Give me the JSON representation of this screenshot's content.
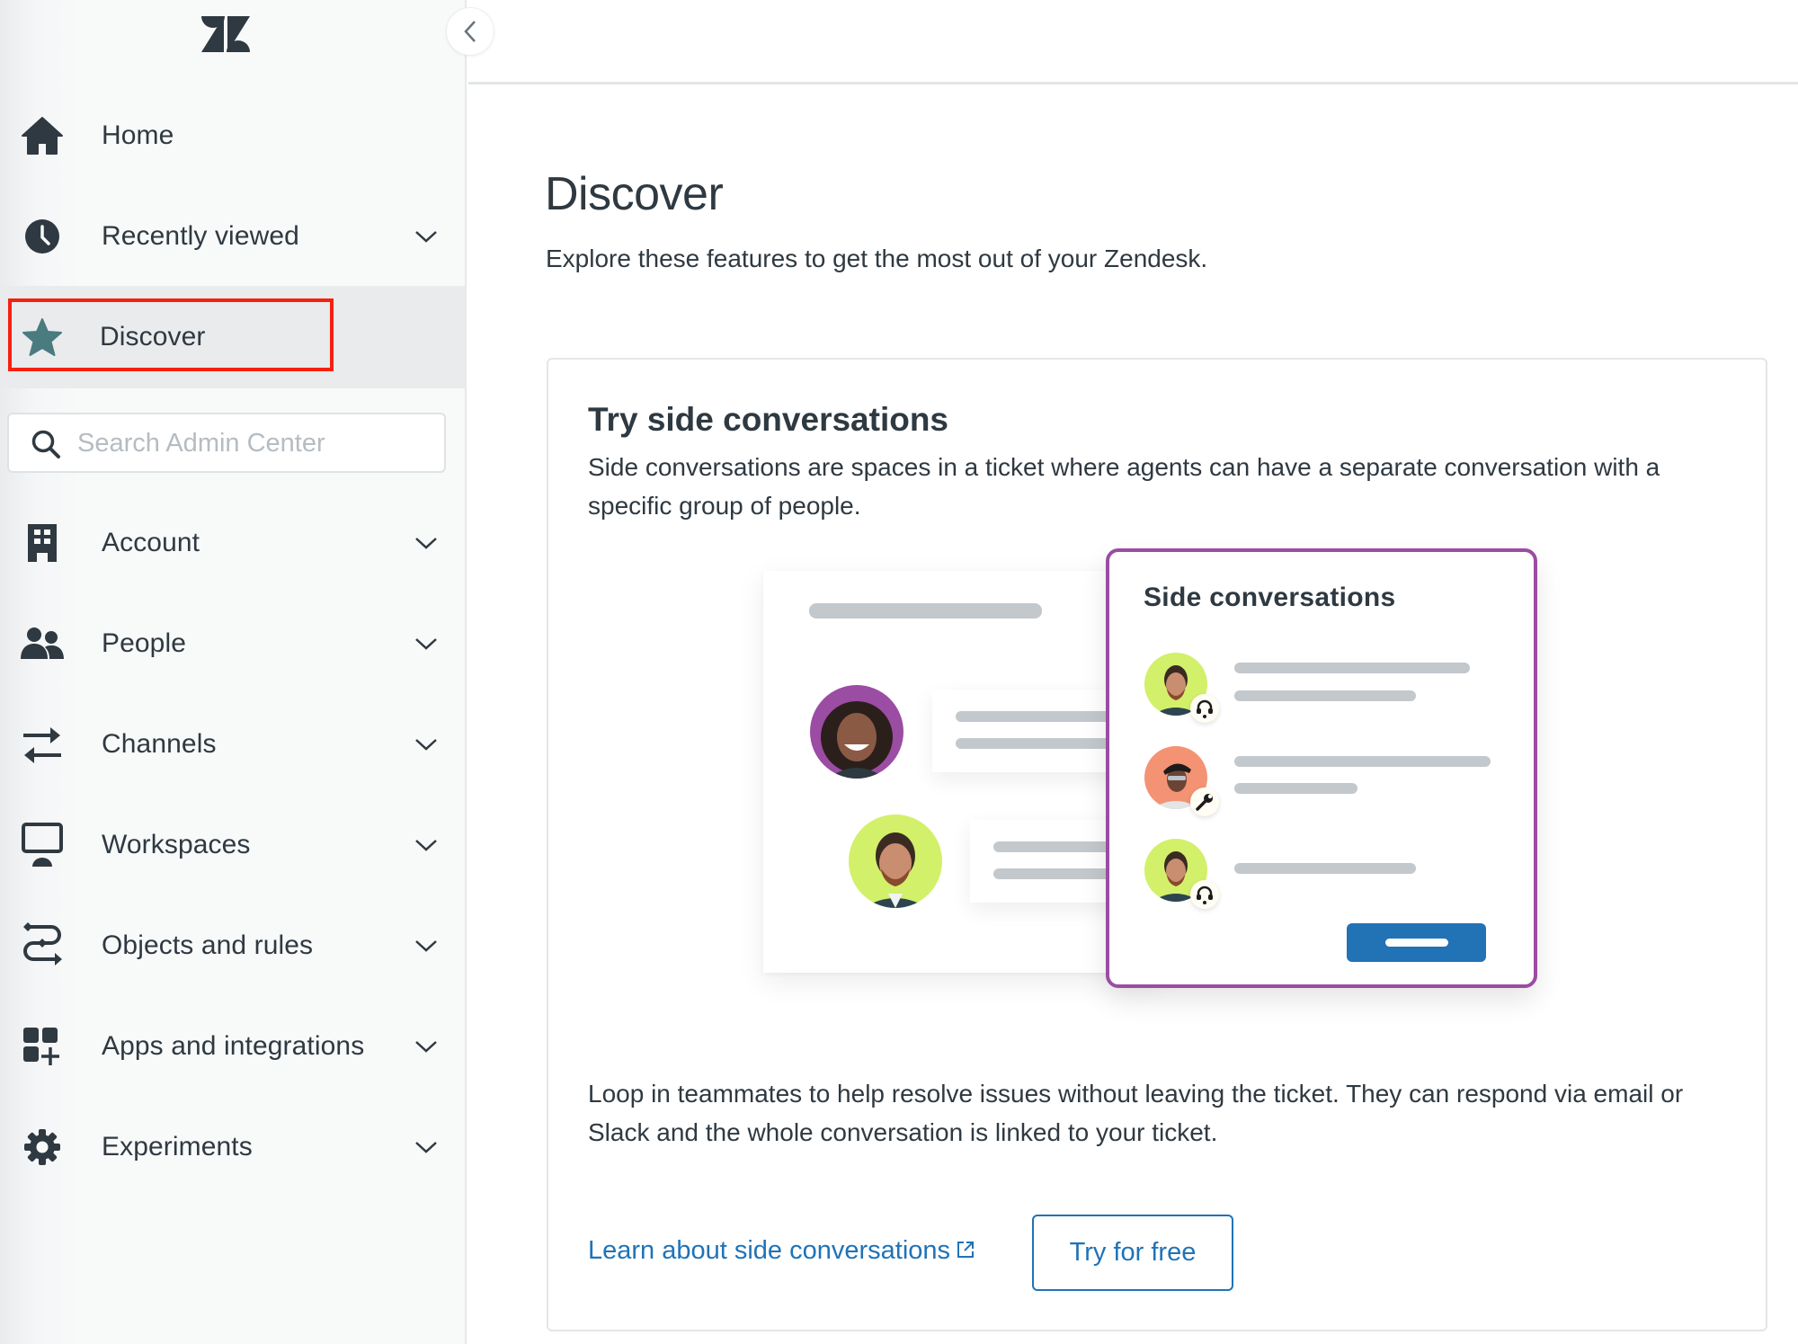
{
  "app": {
    "brand": "Zendesk",
    "logo_icon": "zendesk-logo",
    "collapse_icon": "chevron-left-icon"
  },
  "sidebar": {
    "items": [
      {
        "id": "home",
        "label": "Home",
        "icon": "home-icon",
        "expandable": false,
        "active": false
      },
      {
        "id": "recently-viewed",
        "label": "Recently viewed",
        "icon": "clock-icon",
        "expandable": true,
        "active": false
      },
      {
        "id": "discover",
        "label": "Discover",
        "icon": "star-icon",
        "expandable": false,
        "active": true
      },
      {
        "id": "account",
        "label": "Account",
        "icon": "building-icon",
        "expandable": true,
        "active": false
      },
      {
        "id": "people",
        "label": "People",
        "icon": "people-icon",
        "expandable": true,
        "active": false
      },
      {
        "id": "channels",
        "label": "Channels",
        "icon": "arrows-swap-icon",
        "expandable": true,
        "active": false
      },
      {
        "id": "workspaces",
        "label": "Workspaces",
        "icon": "monitor-icon",
        "expandable": true,
        "active": false
      },
      {
        "id": "objects-and-rules",
        "label": "Objects and rules",
        "icon": "flow-icon",
        "expandable": true,
        "active": false
      },
      {
        "id": "apps-and-integrations",
        "label": "Apps and integrations",
        "icon": "apps-grid-plus-icon",
        "expandable": true,
        "active": false
      },
      {
        "id": "experiments",
        "label": "Experiments",
        "icon": "gear-icon",
        "expandable": true,
        "active": false
      }
    ],
    "search": {
      "placeholder": "Search Admin Center",
      "value": "",
      "icon": "search-icon"
    },
    "highlight_color": "#f5210f",
    "active_icon_color": "#4a7b7f"
  },
  "main": {
    "title": "Discover",
    "subtitle": "Explore these features to get the most out of your Zendesk.",
    "card": {
      "title": "Try side conversations",
      "description": "Side conversations are spaces in a ticket where agents can have a separate conversation with a specific group of people.",
      "illustration": {
        "panel_title": "Side conversations",
        "panel_border_color": "#9b4ca3",
        "button_color": "#2272b6",
        "participants": [
          {
            "avatar_bg": "#d2f06a",
            "role_icon": "headset-icon"
          },
          {
            "avatar_bg": "#f49374",
            "role_icon": "wrench-icon"
          },
          {
            "avatar_bg": "#d2f06a",
            "role_icon": "headset-icon"
          }
        ],
        "ticket_avatars": [
          {
            "avatar_bg": "#9b4ca3"
          },
          {
            "avatar_bg": "#d2f06a"
          }
        ]
      },
      "body": "Loop in teammates to help resolve issues without leaving the ticket. They can respond via email or Slack and the whole conversation is linked to your ticket.",
      "learn_link": "Learn about side conversations",
      "learn_link_icon": "external-link-icon",
      "try_button": "Try for free",
      "accent_color": "#1f73b7"
    }
  }
}
